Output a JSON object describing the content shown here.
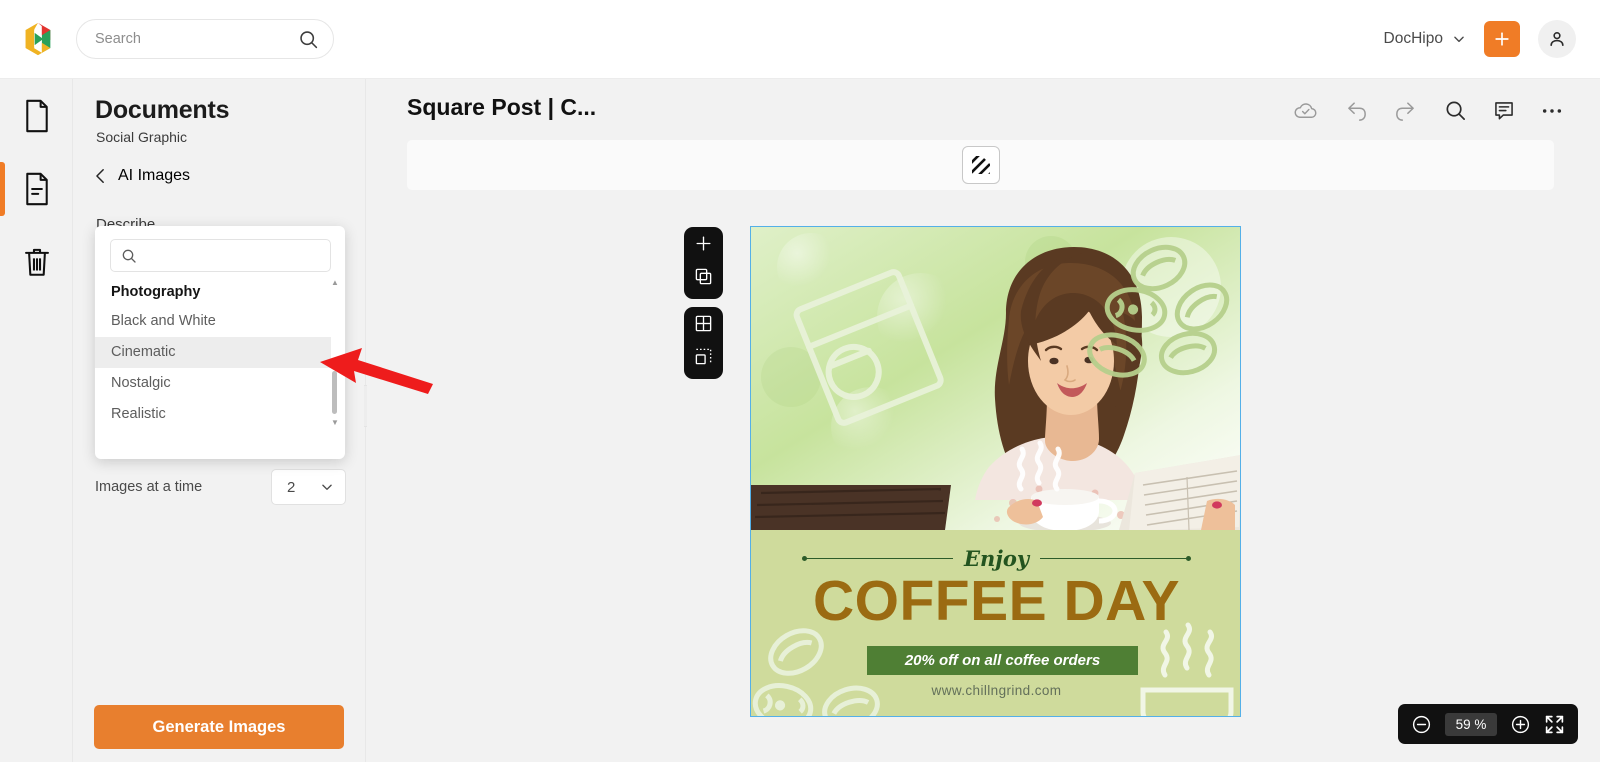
{
  "topbar": {
    "search": {
      "placeholder": "Search",
      "value": "",
      "icon": "search-icon"
    },
    "brand": {
      "label": "DocHipo",
      "icon": "chevron-down-icon"
    },
    "add_label": "+",
    "avatar_icon": "person-icon"
  },
  "rail": {
    "items": [
      {
        "name": "documents",
        "icon": "document-icon",
        "active": false
      },
      {
        "name": "templates",
        "icon": "document-lines-icon",
        "active": true
      },
      {
        "name": "trash",
        "icon": "trash-icon",
        "active": false
      }
    ]
  },
  "panel": {
    "title": "Documents",
    "subtitle": "Social Graphic",
    "back_label": "AI Images",
    "back_icon": "chevron-left-icon",
    "describe_label": "Describe",
    "images_at_a_time_label": "Images at a time",
    "images_count": "2",
    "generate_label": "Generate Images",
    "collapse_icon": "chevron-left-icon"
  },
  "dropdown": {
    "search_placeholder": "",
    "search_value": "",
    "search_icon": "search-icon",
    "group_label": "Photography",
    "options": [
      {
        "label": "Black and White",
        "selected": false
      },
      {
        "label": "Cinematic",
        "selected": true
      },
      {
        "label": "Nostalgic",
        "selected": false
      },
      {
        "label": "Realistic",
        "selected": false
      }
    ]
  },
  "editor": {
    "doc_title": "Square Post | C...",
    "tools": [
      {
        "name": "cloud-saved-icon",
        "label": "Saved"
      },
      {
        "name": "undo-icon",
        "label": "Undo"
      },
      {
        "name": "redo-icon",
        "label": "Redo"
      },
      {
        "name": "search-icon",
        "label": "Find"
      },
      {
        "name": "comment-icon",
        "label": "Comments"
      },
      {
        "name": "more-options-icon",
        "label": "More"
      }
    ],
    "property_bar": {
      "pattern_button_icon": "diagonal-stripes-icon"
    },
    "float_toolbar_1": [
      {
        "name": "add-icon"
      },
      {
        "name": "duplicate-icon"
      }
    ],
    "float_toolbar_2": [
      {
        "name": "grid-icon"
      },
      {
        "name": "crop-icon"
      }
    ],
    "zoom": {
      "minus_icon": "zoom-out-icon",
      "value": "59 %",
      "plus_icon": "zoom-in-icon",
      "fullscreen_icon": "fullscreen-icon"
    }
  },
  "design": {
    "eyebrow": "Enjoy",
    "headline": "COFFEE DAY",
    "offer": "20% off on all coffee orders",
    "website": "www.chillngrind.com",
    "colors": {
      "green_bg": "#cfdb9c",
      "headline": "#9b6b12",
      "banner": "#4f7f34",
      "eyebrow": "#23541f",
      "website": "#63705a"
    }
  },
  "annotation": {
    "arrow_color": "#ee1c1c",
    "points_at": "Cinematic"
  }
}
